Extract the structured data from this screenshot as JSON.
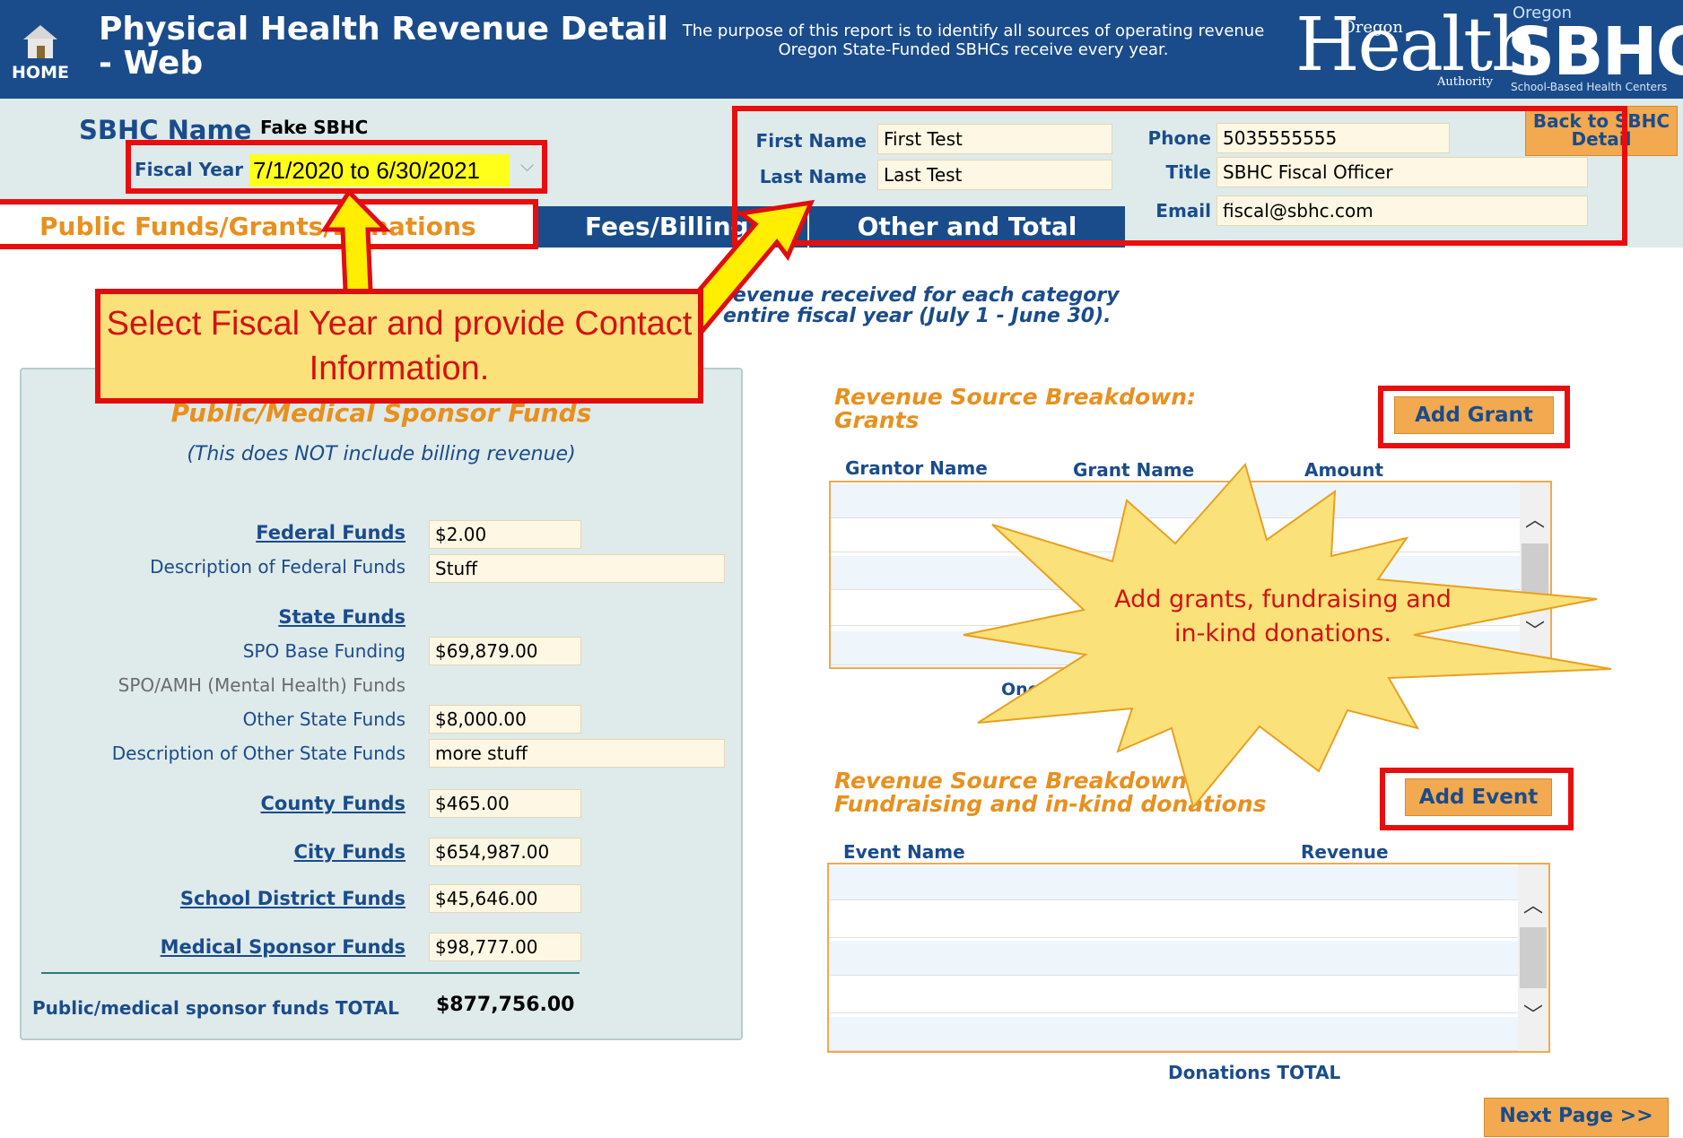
{
  "header": {
    "home_label": "HOME",
    "title": "Physical Health Revenue Detail - Web",
    "purpose": "The purpose of this report is to identify all sources of operating revenue Oregon State-Funded SBHCs receive every year.",
    "oha_logo": {
      "word": "Health",
      "small_top": "Oregon",
      "small_bottom": "Authority"
    },
    "sbhc_logo": {
      "word": "SBHC",
      "small_top": "Oregon",
      "small_bottom": "School-Based Health Centers"
    }
  },
  "info": {
    "sbhc_name_label": "SBHC Name",
    "sbhc_name_value": "Fake SBHC",
    "fiscal_year_label": "Fiscal Year",
    "fiscal_year_value": "7/1/2020 to 6/30/2021",
    "first_name_label": "First Name",
    "first_name_value": "First Test",
    "last_name_label": "Last Name",
    "last_name_value": "Last Test",
    "phone_label": "Phone",
    "phone_value": "5035555555",
    "title_label": "Title",
    "title_value": "SBHC Fiscal Officer",
    "email_label": "Email",
    "email_value": "fiscal@sbhc.com",
    "back_button": "Back to SBHC Detail"
  },
  "tabs": [
    {
      "label": "Public Funds/Grants/Donations"
    },
    {
      "label": "Fees/Billing"
    },
    {
      "label": "Other and Total"
    }
  ],
  "instruction": {
    "line1": "revenue received  for each category",
    "line2": "entire fiscal year (July 1 - June 30)."
  },
  "left_panel": {
    "title": "Public/Medical Sponsor Funds",
    "subtitle": "(This does NOT include billing revenue)",
    "federal_funds_label": "Federal Funds",
    "federal_funds_value": "$2.00",
    "federal_desc_label": "Description of Federal Funds",
    "federal_desc_value": "Stuff",
    "state_funds_label": "State Funds",
    "spo_base_label": "SPO Base Funding",
    "spo_base_value": "$69,879.00",
    "spo_amh_label": "SPO/AMH (Mental Health) Funds",
    "other_state_label": "Other State Funds",
    "other_state_value": "$8,000.00",
    "other_state_desc_label": "Description of Other State Funds",
    "other_state_desc_value": "more stuff",
    "county_label": "County Funds",
    "county_value": "$465.00",
    "city_label": "City Funds",
    "city_value": "$654,987.00",
    "school_label": "School District Funds",
    "school_value": "$45,646.00",
    "medical_label": "Medical Sponsor Funds",
    "medical_value": "$98,777.00",
    "total_label": "Public/medical sponsor funds TOTAL",
    "total_value": "$877,756.00"
  },
  "grants": {
    "title_line1": "Revenue Source Breakdown:",
    "title_line2": "Grants",
    "add_button": "Add Grant",
    "columns": [
      "Grantor Name",
      "Grant Name",
      "Amount"
    ],
    "footer_text": "One time gran"
  },
  "fundraising": {
    "title_line1": "Revenue Source Breakdown:",
    "title_line2": "Fundraising and in-kind donations",
    "add_button": "Add Event",
    "columns": [
      "Event Name",
      "Revenue"
    ],
    "total_label": "Donations TOTAL"
  },
  "annotations": {
    "callout": "Select Fiscal Year and provide Contact Information.",
    "starburst": "Add grants, fundraising and in-kind donations."
  },
  "next_button": "Next Page >>",
  "colors": {
    "brand_blue": "#1a4c8b",
    "accent_orange": "#e8901e",
    "button_orange": "#f2a94f",
    "highlight_red": "#ea0d0d",
    "callout_yellow": "#fbe17a"
  }
}
